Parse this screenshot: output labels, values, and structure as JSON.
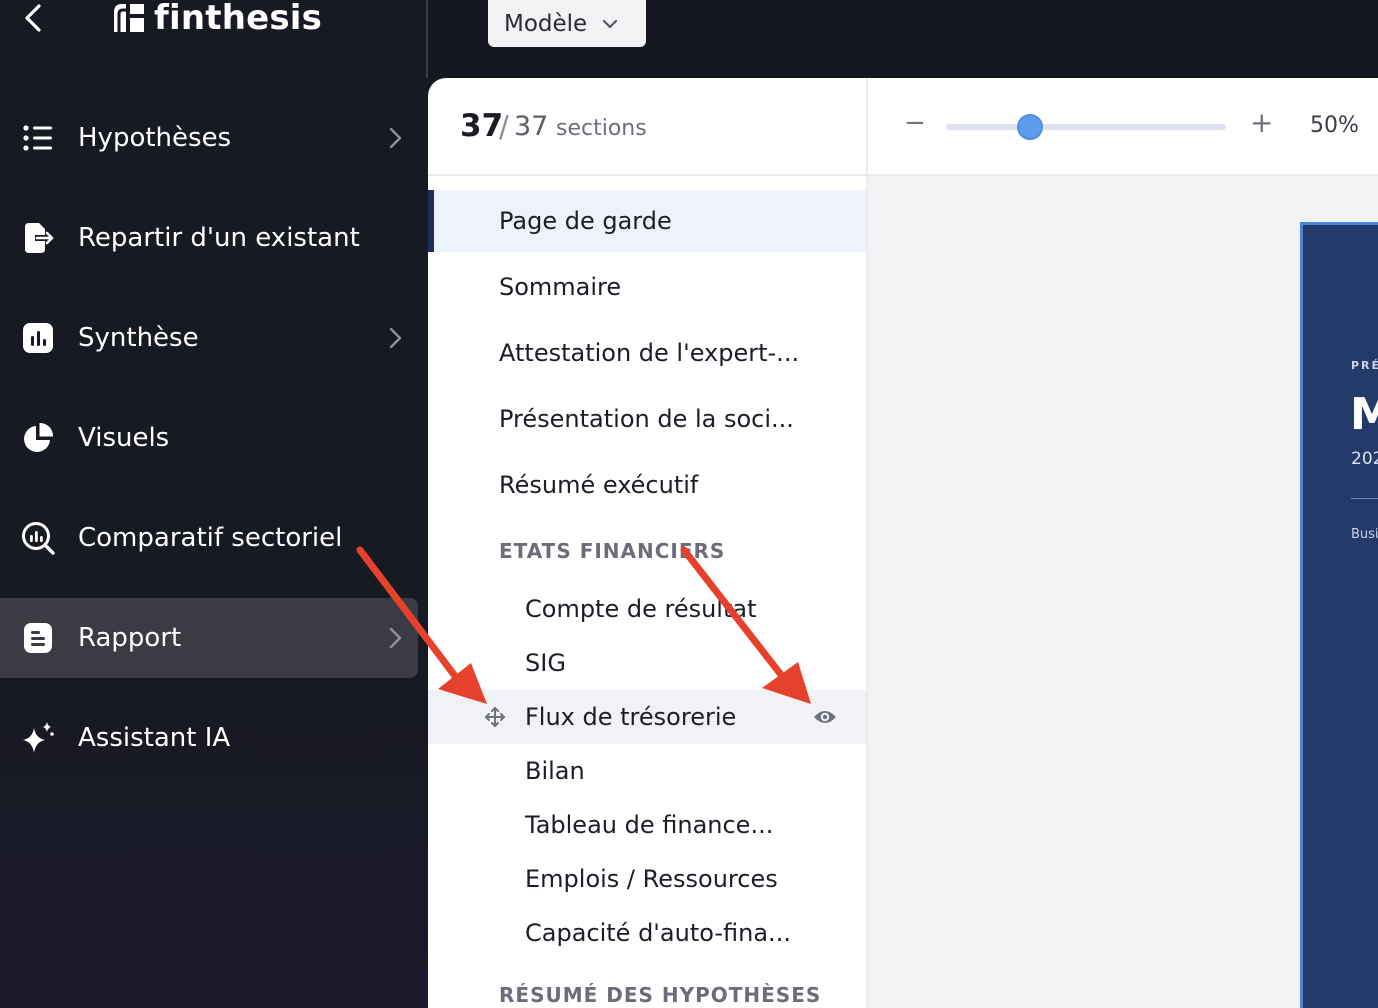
{
  "app": {
    "brand": "finthesis",
    "model_button": "Modèle"
  },
  "sidebar": {
    "items": [
      {
        "label": "Hypothèses",
        "icon": "list-icon",
        "chevron": true
      },
      {
        "label": "Repartir d'un existant",
        "icon": "file-export-icon",
        "chevron": false
      },
      {
        "label": "Synthèse",
        "icon": "bar-chart-icon",
        "chevron": true
      },
      {
        "label": "Visuels",
        "icon": "pie-chart-icon",
        "chevron": false
      },
      {
        "label": "Comparatif sectoriel",
        "icon": "analytics-search-icon",
        "chevron": false
      },
      {
        "label": "Rapport",
        "icon": "report-icon",
        "chevron": true,
        "active": true
      },
      {
        "label": "Assistant IA",
        "icon": "sparkle-icon",
        "chevron": false
      }
    ]
  },
  "sections_panel": {
    "count": "37",
    "separator": "/",
    "total": "37",
    "label": "sections",
    "items": [
      {
        "label": "Page de garde",
        "selected": true
      },
      {
        "label": "Sommaire"
      },
      {
        "label": "Attestation de l'expert-..."
      },
      {
        "label": "Présentation de la soci..."
      },
      {
        "label": "Résumé exécutif"
      }
    ],
    "group_financial": "ETATS FINANCIERS",
    "financial_items": [
      {
        "label": "Compte de résultat"
      },
      {
        "label": "SIG"
      },
      {
        "label": "Flux de trésorerie",
        "hover": true
      },
      {
        "label": "Bilan"
      },
      {
        "label": "Tableau de finance..."
      },
      {
        "label": "Emplois / Ressources"
      },
      {
        "label": "Capacité d'auto-fina..."
      }
    ],
    "group_hypotheses": "RÉSUMÉ DES HYPOTHÈSES"
  },
  "preview": {
    "zoom_minus": "−",
    "zoom_plus": "+",
    "zoom_value": "50%",
    "zoom_level": 0.3,
    "doc": {
      "kicker": "PRÉ",
      "title": "M",
      "year": "202",
      "subtitle": "Busi"
    }
  },
  "colors": {
    "sidebar_bg": "#171923",
    "active_item_bg": "#3b3b44",
    "selected_section_bg": "#eef3fb",
    "slider_accent": "#5d9cec",
    "doc_bg": "#243a6b",
    "arrow": "#e5412c"
  }
}
